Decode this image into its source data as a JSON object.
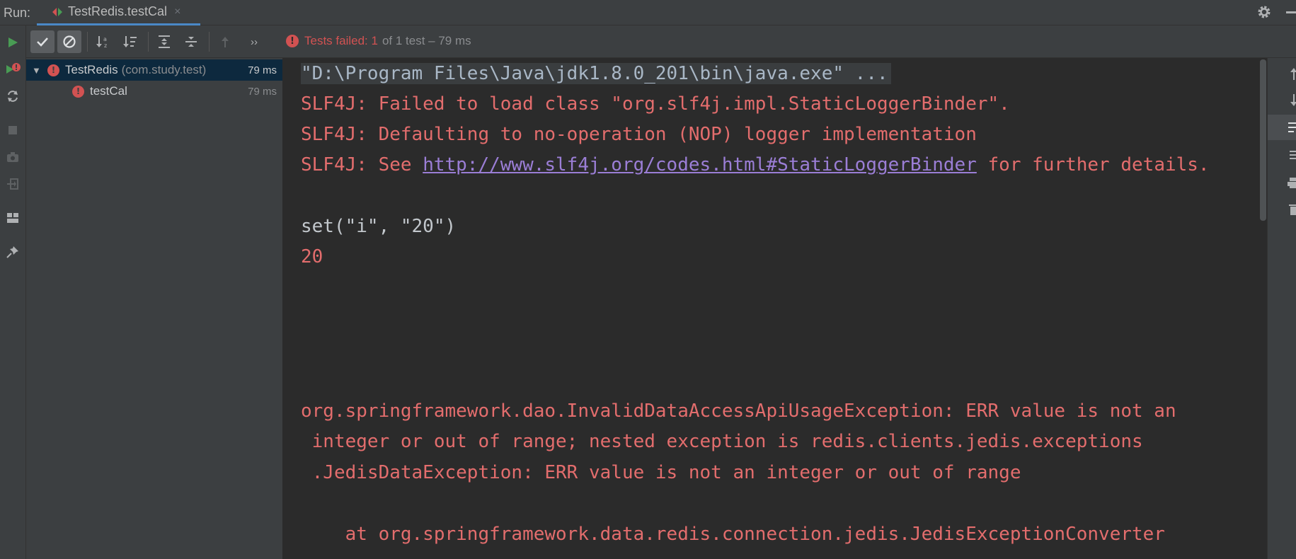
{
  "header": {
    "run_label": "Run:",
    "tab_title": "TestRedis.testCal",
    "tab_close": "×"
  },
  "icons": {
    "top": [
      "config-icon",
      "gear-icon",
      "hide-icon"
    ],
    "left_toolbar": [
      "run-icon",
      "rerun-failed-icon",
      "toggle-auto-test-icon",
      "stop-icon",
      "camera-icon",
      "exit-icon",
      "layout-icon",
      "pin-icon"
    ],
    "test_toolbar": [
      "show-passed-icon",
      "show-ignored-icon",
      "sort-alpha-icon",
      "sort-duration-icon",
      "expand-all-icon",
      "collapse-all-icon",
      "previous-failed-icon",
      "more-icon"
    ],
    "right_toolbar": [
      "up-arrow-icon",
      "down-arrow-icon",
      "soft-wrap-icon",
      "scroll-to-end-icon",
      "print-icon",
      "trash-icon"
    ]
  },
  "test_toolbar": {
    "more_label": "››"
  },
  "status": {
    "failed_text": "Tests failed: 1",
    "rest_text": "of 1 test – 79 ms"
  },
  "tree": {
    "root": {
      "name": "TestRedis",
      "package": "(com.study.test)",
      "time": "79 ms"
    },
    "child": {
      "name": "testCal",
      "time": "79 ms"
    }
  },
  "console": {
    "command": "\"D:\\Program Files\\Java\\jdk1.8.0_201\\bin\\java.exe\" ...",
    "slf4j_1": "SLF4J: Failed to load class \"org.slf4j.impl.StaticLoggerBinder\".",
    "slf4j_2": "SLF4J: Defaulting to no-operation (NOP) logger implementation",
    "slf4j_3_prefix": "SLF4J: See ",
    "slf4j_3_link": "http://www.slf4j.org/codes.html#StaticLoggerBinder",
    "slf4j_3_suffix": " for further details.",
    "set_call": "set(\"i\", \"20\")",
    "value": "20",
    "exception_1": "org.springframework.dao.InvalidDataAccessApiUsageException: ERR value is not an",
    "exception_2": " integer or out of range; nested exception is redis.clients.jedis.exceptions",
    "exception_3": " .JedisDataException: ERR value is not an integer or out of range",
    "stack_1": "    at org.springframework.data.redis.connection.jedis.JedisExceptionConverter"
  },
  "colors": {
    "error": "#d25252",
    "console_error": "#e36d6d",
    "link": "#9b7ed6",
    "selection": "#0d293e",
    "tab_underline": "#4a88c7",
    "run_green": "#499c54"
  }
}
